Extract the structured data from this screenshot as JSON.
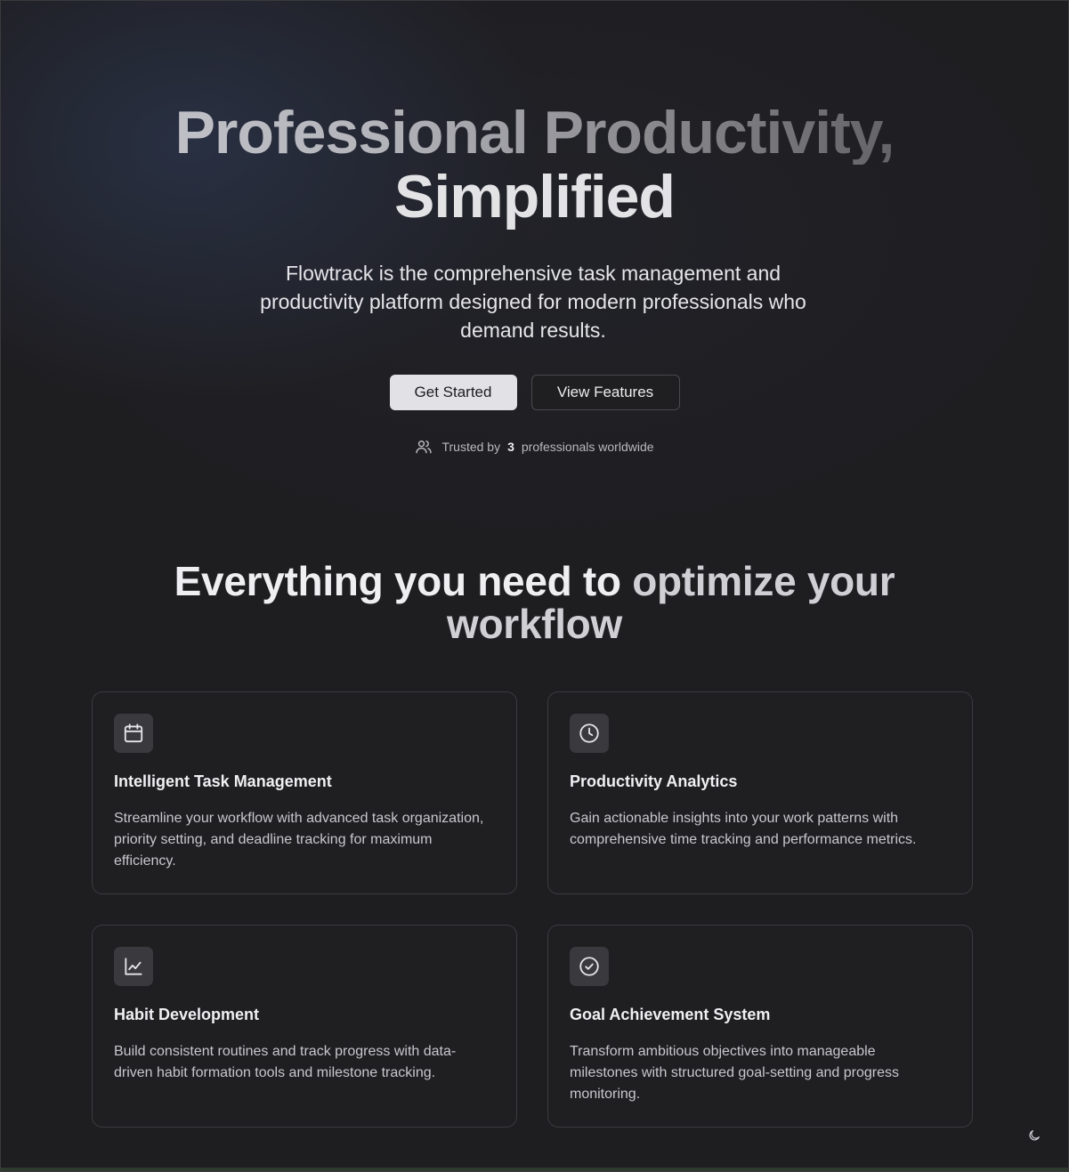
{
  "hero": {
    "title_line1": "Professional Productivity,",
    "title_line2": "Simplified",
    "subtitle": "Flowtrack is the comprehensive task management and productivity platform designed for modern professionals who demand results.",
    "primary_cta": "Get Started",
    "secondary_cta": "View Features",
    "trusted_prefix": "Trusted by",
    "trusted_count": "3",
    "trusted_suffix": "professionals worldwide",
    "trusted_icon": "users-icon"
  },
  "features": {
    "title_part1": "Everything you need to",
    "title_part2": "optimize your",
    "title_part3": "workflow",
    "cards": [
      {
        "icon": "calendar-icon",
        "title": "Intelligent Task Management",
        "description": "Streamline your workflow with advanced task organization, priority setting, and deadline tracking for maximum efficiency."
      },
      {
        "icon": "clock-icon",
        "title": "Productivity Analytics",
        "description": "Gain actionable insights into your work patterns with comprehensive time tracking and performance metrics."
      },
      {
        "icon": "line-chart-icon",
        "title": "Habit Development",
        "description": "Build consistent routines and track progress with data-driven habit formation tools and milestone tracking."
      },
      {
        "icon": "check-circle-icon",
        "title": "Goal Achievement System",
        "description": "Transform ambitious objectives into manageable milestones with structured goal-setting and progress monitoring."
      }
    ]
  },
  "theme_toggle": {
    "icon": "moon-icon"
  },
  "colors": {
    "background": "#1e1d20",
    "card_background": "#1f1e21",
    "primary_button": "#e2e1e5",
    "hero_glow": "#303e5c"
  }
}
